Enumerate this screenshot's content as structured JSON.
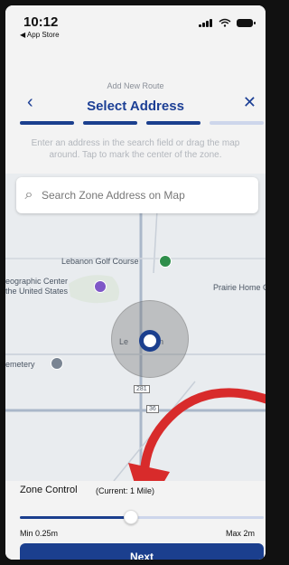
{
  "status_bar": {
    "time": "10:12",
    "back_label": "◀ App Store"
  },
  "header": {
    "subtitle": "Add New Route",
    "title": "Select Address",
    "back_icon": "chevron-left-icon",
    "close_icon": "close-icon"
  },
  "progress": {
    "steps": [
      true,
      true,
      true,
      false
    ]
  },
  "instruction": "Enter an address in the search field or drag the map around. Tap to mark the center of the zone.",
  "search": {
    "placeholder": "Search Zone Address on Map"
  },
  "map": {
    "labels": {
      "golf": "Lebanon Golf Course",
      "geo": "eographic Center",
      "geo2": "the United States",
      "prairie": "Prairie Home C",
      "cemetery": "emetery",
      "town": "Le",
      "town2": "n",
      "hwy281": "281",
      "hwy36": "36"
    }
  },
  "zone_control": {
    "label": "Zone Control",
    "current": "(Current: 1 Mile)",
    "slider_value_fraction": 0.45,
    "min_label": "Min 0.25m",
    "max_label": "Max 2m"
  },
  "buttons": {
    "next": "Next"
  },
  "colors": {
    "primary": "#1b3f8e",
    "accent_arrow": "#d82b2b"
  }
}
